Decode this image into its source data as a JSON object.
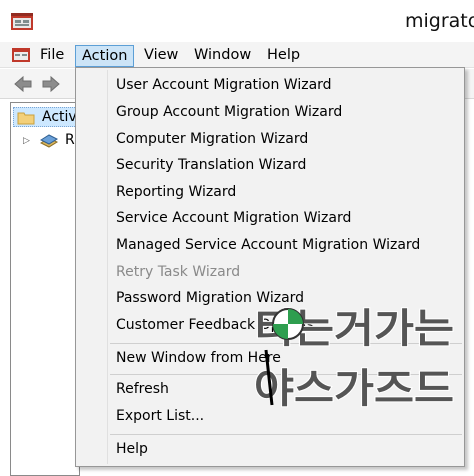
{
  "window": {
    "title": "migrator"
  },
  "menubar": {
    "items": [
      {
        "label": "File"
      },
      {
        "label": "Action"
      },
      {
        "label": "View"
      },
      {
        "label": "Window"
      },
      {
        "label": "Help"
      }
    ]
  },
  "toolbar": {
    "icons": [
      "back-arrow-icon",
      "forward-arrow-icon"
    ]
  },
  "tree": {
    "items": [
      {
        "label": "Activ"
      },
      {
        "label": "R"
      }
    ]
  },
  "action_menu": {
    "items": [
      {
        "label": "User Account Migration Wizard",
        "enabled": true
      },
      {
        "label": "Group Account Migration Wizard",
        "enabled": true
      },
      {
        "label": "Computer Migration Wizard",
        "enabled": true
      },
      {
        "label": "Security Translation Wizard",
        "enabled": true
      },
      {
        "label": "Reporting Wizard",
        "enabled": true
      },
      {
        "label": "Service Account Migration Wizard",
        "enabled": true
      },
      {
        "label": "Managed Service Account Migration Wizard",
        "enabled": true
      },
      {
        "label": "Retry Task Wizard",
        "enabled": false
      },
      {
        "label": "Password Migration Wizard",
        "enabled": true
      },
      {
        "label": "Customer Feedback Options...",
        "enabled": true
      },
      {
        "label": "New Window from Here",
        "enabled": true
      },
      {
        "label": "Refresh",
        "enabled": true
      },
      {
        "label": "Export List...",
        "enabled": true
      },
      {
        "label": "Help",
        "enabled": true
      }
    ]
  },
  "watermark": {
    "line1": "티는거가는",
    "line2": "야스가즈드"
  },
  "colors": {
    "menu_highlight": "#cce4f7",
    "menu_highlight_border": "#5c9fd6",
    "menu_background": "#f2f2f2",
    "disabled_text": "#8a8a8a",
    "tree_selection": "#cde8ff"
  }
}
